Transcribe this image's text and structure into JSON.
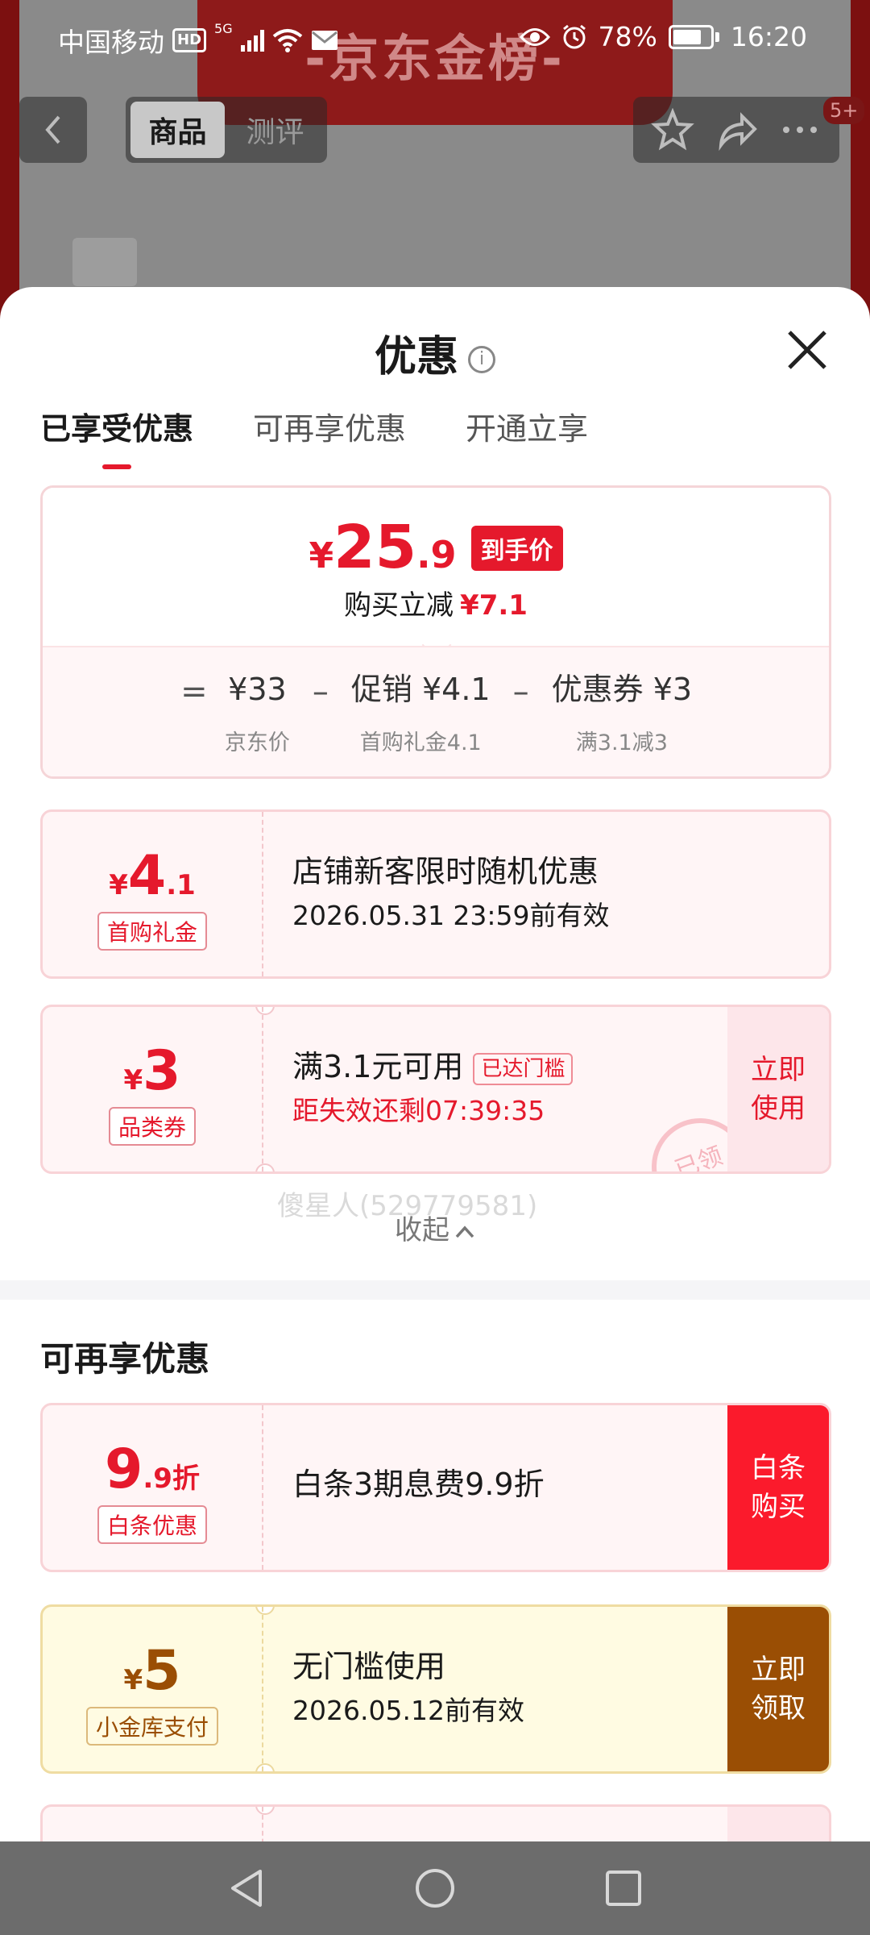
{
  "status_bar": {
    "carrier": "中国移动",
    "hd": "HD",
    "network": "5G",
    "battery": "78%",
    "time": "16:20"
  },
  "background": {
    "banner_text": "-京东金榜-",
    "segments": [
      "商品",
      "测评"
    ],
    "badge": "5+"
  },
  "sheet": {
    "title": "优惠",
    "tabs": [
      "已享受优惠",
      "可再享优惠",
      "开通立享"
    ],
    "summary": {
      "currency": "¥",
      "price_int": "25",
      "price_dec": ".9",
      "price_tag": "到手价",
      "reduce_label": "购买立减",
      "reduce_value": "¥7.1",
      "formula": {
        "eq": "=",
        "minus": "–",
        "base_value": "¥33",
        "base_label": "京东价",
        "promo_value": "促销 ¥4.1",
        "promo_label": "首购礼金4.1",
        "coupon_value": "优惠券 ¥3",
        "coupon_label": "满3.1减3"
      }
    },
    "coupons_enjoyed": [
      {
        "currency": "¥",
        "amount": "4",
        "decimal": ".1",
        "label": "首购礼金",
        "title": "店铺新客限时随机优惠",
        "subtitle": "2026.05.31 23:59前有效"
      },
      {
        "currency": "¥",
        "amount": "3",
        "label": "品类券",
        "title": "满3.1元可用",
        "reached": "已达门槛",
        "subtitle": "距失效还剩07:39:35",
        "action": "立即使用",
        "stamp": "已领"
      }
    ],
    "watermark": "傻星人(529779581)",
    "collapse_label": "收起",
    "more_section_title": "可再享优惠",
    "coupons_more": [
      {
        "amount": "9",
        "decimal": ".9折",
        "label": "白条优惠",
        "title": "白条3期息费9.9折",
        "action": "白条购买"
      },
      {
        "currency": "¥",
        "amount": "5",
        "label": "小金库支付",
        "title": "无门槛使用",
        "subtitle": "2026.05.12前有效",
        "action": "立即领取"
      }
    ]
  },
  "colors": {
    "accent_red": "#e5192c",
    "gold_brown": "#9a4e04"
  }
}
